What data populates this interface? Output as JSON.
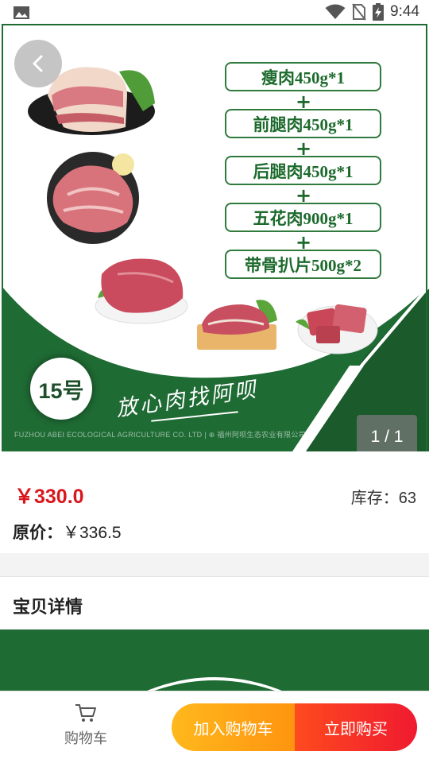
{
  "status_bar": {
    "time": "9:44",
    "icons": [
      "image-icon",
      "wifi-icon",
      "no-sim-icon",
      "battery-charging-icon"
    ]
  },
  "banner": {
    "items": [
      "瘦肉450g*1",
      "前腿肉450g*1",
      "后腿肉450g*1",
      "五花肉900g*1",
      "带骨扒片500g*2"
    ],
    "plus": "+",
    "badge": "15号",
    "slogan": "放心肉找阿呗",
    "company": "FUZHOU ABEI ECOLOGICAL AGRICULTURE CO. LTD  |  ⊕ 福州阿呗生态农业有限公司",
    "page_indicator": "1 / 1",
    "brand_green": "#1f6b34"
  },
  "product": {
    "price": "￥330.0",
    "stock_label": "库存：",
    "stock_value": "63",
    "original_label": "原价：",
    "original_value": "￥336.5"
  },
  "details": {
    "title": "宝贝详情"
  },
  "bottom_bar": {
    "cart_label": "购物车",
    "add_to_cart": "加入购物车",
    "buy_now": "立即购买",
    "add_color": "#ff9410",
    "buy_color": "#ef1a30"
  }
}
